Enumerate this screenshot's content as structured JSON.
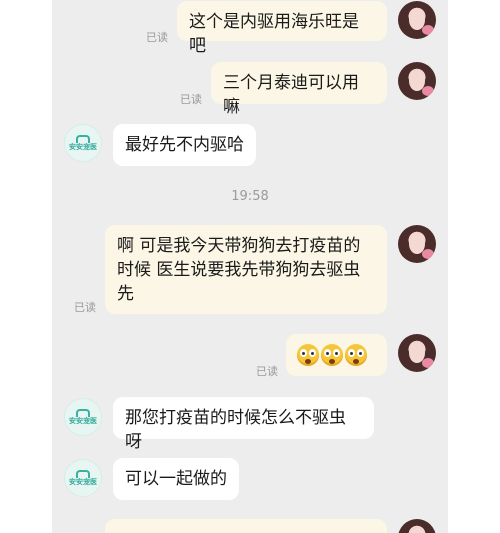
{
  "messages": [
    {
      "side": "me",
      "text": "这个是内驱用海乐旺是吧",
      "status": "已读"
    },
    {
      "side": "me",
      "text": "三个月泰迪可以用嘛",
      "status": "已读"
    },
    {
      "side": "them",
      "text": "最好先不内驱哈"
    },
    {
      "side": "me",
      "lines": [
        "啊 可是我今天带狗狗去打疫苗的",
        "时候 医生说要我先带狗狗去驱虫",
        "先"
      ],
      "status": "已读"
    },
    {
      "side": "me",
      "emoji": [
        "surprised-face-emoji",
        "surprised-face-emoji",
        "surprised-face-emoji"
      ],
      "status": "已读"
    },
    {
      "side": "them",
      "text": "那您打疫苗的时候怎么不驱虫呀"
    },
    {
      "side": "them",
      "text": "可以一起做的"
    }
  ],
  "timestamp": "19:58",
  "shop_avatar_label": "安安宠医",
  "colors": {
    "background": "#ededed",
    "my_bubble": "#fbf6e5",
    "their_bubble": "#ffffff",
    "read_text": "#9a9a9a",
    "brand_teal": "#2fa897"
  }
}
